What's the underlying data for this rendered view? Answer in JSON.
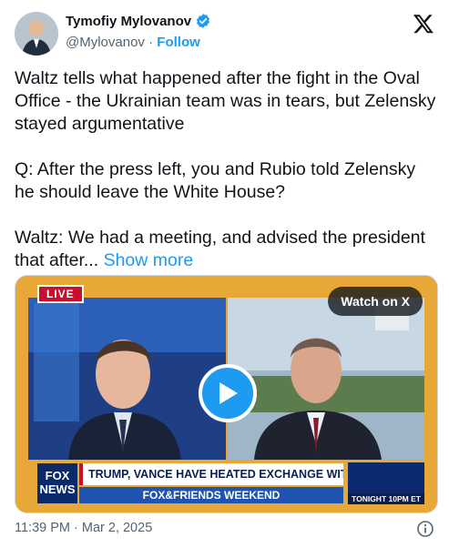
{
  "author": {
    "display_name": "Tymofiy Mylovanov",
    "handle": "@Mylovanov",
    "separator": " · ",
    "follow_label": "Follow"
  },
  "tweet": {
    "paragraphs": [
      "Waltz tells what happened after the fight in the Oval Office - the Ukrainian team was in tears, but Zelensky stayed argumentative",
      "Q: After the press left, you and Rubio told Zelensky he should leave the White House?"
    ],
    "last_paragraph": "Waltz: We had a meeting, and advised the president that after...",
    "show_more_label": "Show more"
  },
  "media": {
    "watch_label": "Watch on X",
    "live_label": "LIVE",
    "network_logo": "FOX NEWS",
    "headline": "TRUMP, VANCE HAVE HEATED EXCHANGE WITH ZELENSKYY",
    "show_bar": "FOX&FRIENDS WEEKEND",
    "promo": "TONIGHT 10PM ET"
  },
  "footer": {
    "timestamp": "11:39 PM · Mar 2, 2025"
  },
  "colors": {
    "accent": "#1d9bf0",
    "text": "#0f1419",
    "muted": "#536471"
  },
  "icons": [
    "verified-badge-icon",
    "x-logo-icon",
    "play-icon",
    "info-icon"
  ]
}
